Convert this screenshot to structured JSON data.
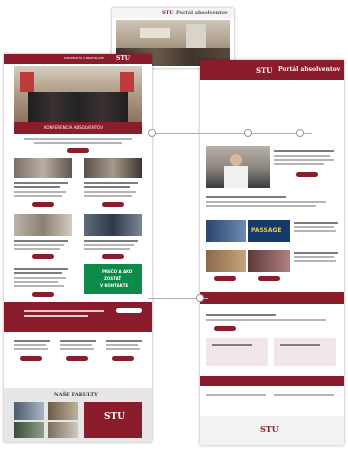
{
  "top_sheet": {
    "logo": "STU",
    "title": "Portál absolventov"
  },
  "left_sheet": {
    "brand_line": "UNIVERZITA V BRATISLAVE",
    "logo": "STU",
    "hero_caption": "KONFERENCIA ABSOLVENTOV",
    "green_banner_lines": [
      "PREČO A AKO",
      "ZOSTAŤ",
      "V KONTAKTE"
    ],
    "bottom_title": "NAŠE FAKULTY",
    "bottom_logo": "STU"
  },
  "right_sheet": {
    "logo": "STU",
    "title": "Portál absolventov",
    "banner_word": "PASSAGE",
    "footer_logo": "STU"
  },
  "colors": {
    "brand": "#8a1c2b",
    "accent_green": "#0c8a4a",
    "panel_gray": "#e6e6e6"
  },
  "icons": [
    "connector-dot-icon"
  ]
}
